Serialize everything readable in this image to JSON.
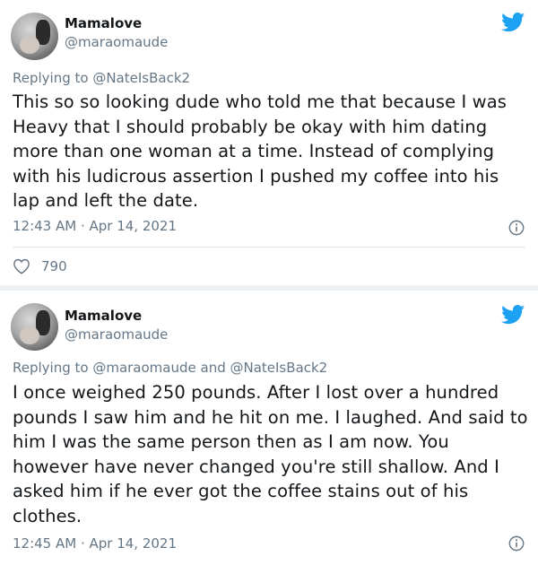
{
  "tweets": [
    {
      "display_name": "Mamalove",
      "handle": "@maraomaude",
      "replying_to": "Replying to @NateIsBack2",
      "text": "This so so looking dude who told me that because I was Heavy that I should probably be okay with him dating more than one woman at a time. Instead of complying with his ludicrous assertion I pushed my coffee into his lap and left the date.",
      "timestamp": "12:43 AM · Apr 14, 2021",
      "likes": "790"
    },
    {
      "display_name": "Mamalove",
      "handle": "@maraomaude",
      "replying_to": "Replying to @maraomaude and @NateIsBack2",
      "text": "I once weighed 250 pounds. After I lost over a hundred pounds I saw him and he hit on me. I laughed. And said to him I was the same person then as I am now. You however have never changed you're still shallow. And I asked him if he ever got the coffee stains out of his clothes.",
      "timestamp": "12:45 AM · Apr 14, 2021"
    }
  ],
  "icons": {
    "brand": "twitter-bird-icon",
    "info": "info-icon",
    "like": "heart-icon"
  },
  "colors": {
    "twitter_blue": "#1da1f2",
    "secondary_text": "#657786",
    "primary_text": "#14171a"
  }
}
